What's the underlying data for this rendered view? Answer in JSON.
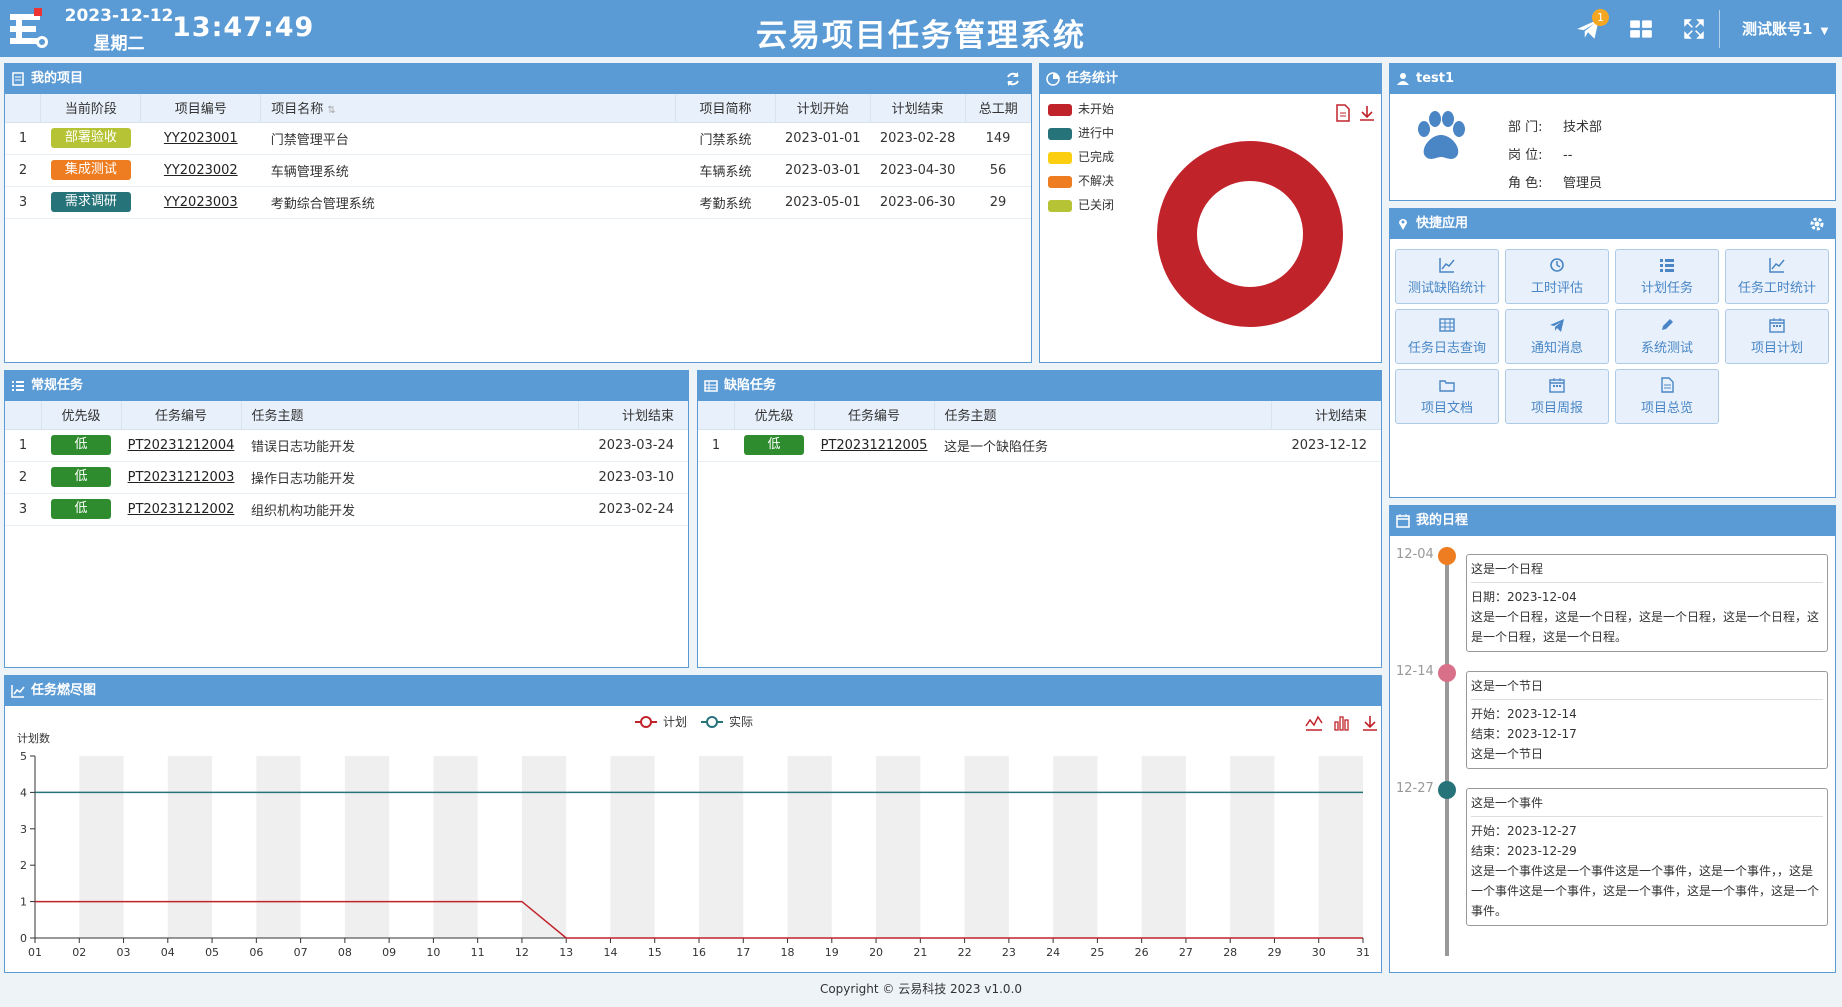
{
  "header": {
    "date": "2023-12-12",
    "weekday": "星期二",
    "time": "13:47:49",
    "title": "云易项目任务管理系统",
    "notify_count": "1",
    "user": "测试账号1",
    "icons": [
      "paper-plane-icon",
      "grid-icon",
      "fullscreen-icon",
      "caret-down-icon"
    ]
  },
  "projects": {
    "title": "我的项目",
    "columns": [
      "当前阶段",
      "项目编号",
      "项目名称",
      "项目简称",
      "计划开始",
      "计划结束",
      "总工期"
    ],
    "rows": [
      {
        "idx": "1",
        "stage": "部署验收",
        "stage_color": "#b5c334",
        "code": "YY2023001",
        "name": "门禁管理平台",
        "short": "门禁系统",
        "start": "2023-01-01",
        "end": "2023-02-28",
        "days": "149"
      },
      {
        "idx": "2",
        "stage": "集成测试",
        "stage_color": "#ee7d21",
        "code": "YY2023002",
        "name": "车辆管理系统",
        "short": "车辆系统",
        "start": "2023-03-01",
        "end": "2023-04-30",
        "days": "56"
      },
      {
        "idx": "3",
        "stage": "需求调研",
        "stage_color": "#26737a",
        "code": "YY2023003",
        "name": "考勤综合管理系统",
        "short": "考勤系统",
        "start": "2023-05-01",
        "end": "2023-06-30",
        "days": "29"
      }
    ]
  },
  "stats": {
    "title": "任务统计",
    "legend": [
      {
        "label": "未开始",
        "color": "#c1232b"
      },
      {
        "label": "进行中",
        "color": "#26737a"
      },
      {
        "label": "已完成",
        "color": "#fcce10"
      },
      {
        "label": "不解决",
        "color": "#ee7d21"
      },
      {
        "label": "已关闭",
        "color": "#b5c334"
      }
    ]
  },
  "profile": {
    "name": "test1",
    "fields": [
      {
        "key": "部 门:",
        "value": "技术部"
      },
      {
        "key": "岗 位:",
        "value": "--"
      },
      {
        "key": "角 色:",
        "value": "管理员"
      }
    ]
  },
  "quick": {
    "title": "快捷应用",
    "apps": [
      {
        "label": "测试缺陷统计",
        "icon": "line-chart-icon"
      },
      {
        "label": "工时评估",
        "icon": "clock-icon"
      },
      {
        "label": "计划任务",
        "icon": "list-icon"
      },
      {
        "label": "任务工时统计",
        "icon": "line-chart-icon"
      },
      {
        "label": "任务日志查询",
        "icon": "table-icon"
      },
      {
        "label": "通知消息",
        "icon": "paper-plane-icon"
      },
      {
        "label": "系统测试",
        "icon": "pencil-icon"
      },
      {
        "label": "项目计划",
        "icon": "calendar-icon"
      },
      {
        "label": "项目文档",
        "icon": "folder-icon"
      },
      {
        "label": "项目周报",
        "icon": "calendar-icon"
      },
      {
        "label": "项目总览",
        "icon": "file-icon"
      }
    ]
  },
  "routine": {
    "title": "常规任务",
    "columns": [
      "优先级",
      "任务编号",
      "任务主题",
      "计划结束"
    ],
    "rows": [
      {
        "idx": "1",
        "priority": "低",
        "code": "PT20231212004",
        "subject": "错误日志功能开发",
        "end": "2023-03-24"
      },
      {
        "idx": "2",
        "priority": "低",
        "code": "PT20231212003",
        "subject": "操作日志功能开发",
        "end": "2023-03-10"
      },
      {
        "idx": "3",
        "priority": "低",
        "code": "PT20231212002",
        "subject": "组织机构功能开发",
        "end": "2023-02-24"
      }
    ]
  },
  "defects": {
    "title": "缺陷任务",
    "columns": [
      "优先级",
      "任务编号",
      "任务主题",
      "计划结束"
    ],
    "rows": [
      {
        "idx": "1",
        "priority": "低",
        "code": "PT20231212005",
        "subject": "这是一个缺陷任务",
        "end": "2023-12-12"
      }
    ]
  },
  "schedule": {
    "title": "我的日程",
    "items": [
      {
        "date": "12-04",
        "color": "#ee7d21",
        "title": "这是一个日程",
        "lines": [
          "日期：2023-12-04",
          "这是一个日程，这是一个日程，这是一个日程，这是一个日程，这是一个日程，这是一个日程。"
        ]
      },
      {
        "date": "12-14",
        "color": "#d9708a",
        "title": "这是一个节日",
        "lines": [
          "开始：2023-12-14",
          "结束：2023-12-17",
          "这是一个节日"
        ]
      },
      {
        "date": "12-27",
        "color": "#26737a",
        "title": "这是一个事件",
        "lines": [
          "开始：2023-12-27",
          "结束：2023-12-29",
          "这是一个事件这是一个事件这是一个事件，这是一个事件，，这是一个事件这是一个事件，这是一个事件，这是一个事件，这是一个事件。"
        ]
      }
    ]
  },
  "burndown": {
    "title": "任务燃尽图"
  },
  "chart_data": {
    "type": "line",
    "ylabel": "计划数",
    "ylim": [
      0,
      5
    ],
    "yticks": [
      "0",
      "1",
      "2",
      "3",
      "4",
      "5"
    ],
    "categories": [
      "01",
      "02",
      "03",
      "04",
      "05",
      "06",
      "07",
      "08",
      "09",
      "10",
      "11",
      "12",
      "13",
      "14",
      "15",
      "16",
      "17",
      "18",
      "19",
      "20",
      "21",
      "22",
      "23",
      "24",
      "25",
      "26",
      "27",
      "28",
      "29",
      "30",
      "31"
    ],
    "series": [
      {
        "name": "计划",
        "color": "#c1232b",
        "values": [
          1,
          1,
          1,
          1,
          1,
          1,
          1,
          1,
          1,
          1,
          1,
          1,
          0,
          0,
          0,
          0,
          0,
          0,
          0,
          0,
          0,
          0,
          0,
          0,
          0,
          0,
          0,
          0,
          0,
          0,
          0
        ]
      },
      {
        "name": "实际",
        "color": "#26737a",
        "values": [
          4,
          4,
          4,
          4,
          4,
          4,
          4,
          4,
          4,
          4,
          4,
          4,
          4,
          4,
          4,
          4,
          4,
          4,
          4,
          4,
          4,
          4,
          4,
          4,
          4,
          4,
          4,
          4,
          4,
          4,
          4
        ]
      }
    ],
    "legend_position": "top-center",
    "grid": "alternating-vertical-bands"
  },
  "footer": {
    "copyright": "Copyright © 云易科技 2023 v1.0.0"
  }
}
